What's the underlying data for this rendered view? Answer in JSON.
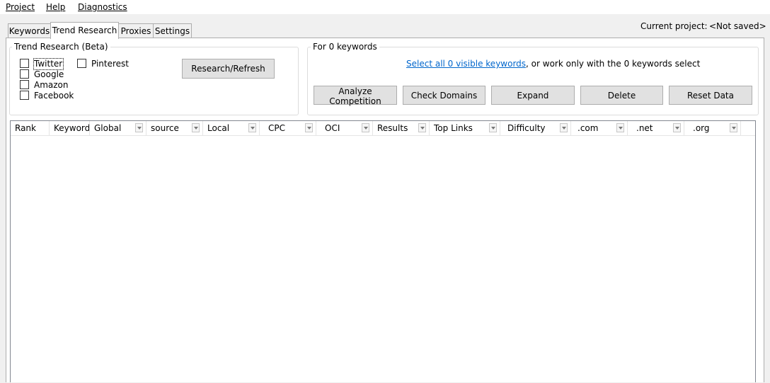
{
  "menu": [
    "Project",
    "Help",
    "Diagnostics"
  ],
  "tabs": [
    "Keywords",
    "Trend Research",
    "Proxies",
    "Settings"
  ],
  "active_tab": "Trend Research",
  "current_project": {
    "label": "Current project:",
    "value": "<Not saved>"
  },
  "trend_research": {
    "group_title": "Trend Research (Beta)",
    "sources": [
      {
        "label": "Twitter",
        "checked": false
      },
      {
        "label": "Google",
        "checked": false
      },
      {
        "label": "Amazon",
        "checked": false
      },
      {
        "label": "Facebook",
        "checked": false
      },
      {
        "label": "Pinterest",
        "checked": false
      }
    ],
    "research_button": "Research/Refresh"
  },
  "keywords_group": {
    "title": "For 0 keywords",
    "select_link": "Select all 0 visible keywords",
    "select_rest": ", or work only with the 0 keywords select",
    "buttons": [
      "Analyze Competition",
      "Check Domains",
      "Expand",
      "Delete",
      "Reset Data"
    ]
  },
  "grid": {
    "columns": [
      {
        "label": "Rank",
        "filter": false
      },
      {
        "label": "Keyword",
        "filter": false
      },
      {
        "label": "Global",
        "filter": true
      },
      {
        "label": "source",
        "filter": true
      },
      {
        "label": "Local",
        "filter": true
      },
      {
        "label": "CPC",
        "filter": true
      },
      {
        "label": "OCI",
        "filter": true
      },
      {
        "label": "Results",
        "filter": true
      },
      {
        "label": "Top Links",
        "filter": true
      },
      {
        "label": "Difficulty",
        "filter": true
      },
      {
        "label": ".com",
        "filter": true
      },
      {
        "label": ".net",
        "filter": true
      },
      {
        "label": ".org",
        "filter": true
      }
    ],
    "rows": []
  }
}
